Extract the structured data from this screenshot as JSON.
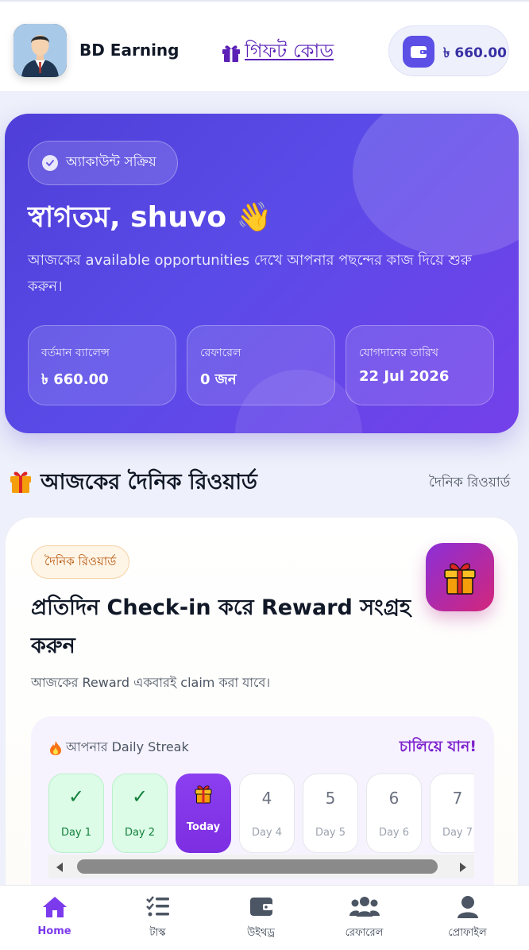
{
  "header": {
    "app_name": "BD Earning",
    "gift_code_label": "গিফট কোড",
    "wallet_amount": "৳ 660.00"
  },
  "hero": {
    "status_chip": "অ্যাকাউন্ট সক্রিয়",
    "welcome": "স্বাগতম, shuvo 👋",
    "description": "আজকের available opportunities দেখে আপনার পছন্দের কাজ দিয়ে শুরু করুন।",
    "stats": [
      {
        "label": "বর্তমান ব্যালেন্স",
        "value": "৳ 660.00"
      },
      {
        "label": "রেফারেল",
        "value": "0 জন"
      },
      {
        "label": "যোগদানের তারিখ",
        "value": "22 Jul 2026"
      }
    ]
  },
  "section": {
    "title": "আজকের দৈনিক রিওয়ার্ড",
    "link": "দৈনিক রিওয়ার্ড"
  },
  "reward": {
    "chip": "দৈনিক রিওয়ার্ড",
    "title": "প্রতিদিন Check-in করে Reward সংগ্রহ করুন",
    "subtitle": "আজকের Reward একবারই claim করা যাবে।",
    "streak_label": "আপনার Daily Streak",
    "streak_cta": "চালিয়ে যান!",
    "days": [
      {
        "mark": "✓",
        "label": "Day 1",
        "state": "done"
      },
      {
        "mark": "✓",
        "label": "Day 2",
        "state": "done"
      },
      {
        "mark": "gift-icon",
        "label": "Today",
        "state": "today"
      },
      {
        "mark": "4",
        "label": "Day 4",
        "state": "upcoming"
      },
      {
        "mark": "5",
        "label": "Day 5",
        "state": "upcoming"
      },
      {
        "mark": "6",
        "label": "Day 6",
        "state": "upcoming"
      },
      {
        "mark": "7",
        "label": "Day 7",
        "state": "upcoming"
      }
    ]
  },
  "nav": {
    "items": [
      {
        "label": "Home",
        "icon": "home-icon",
        "active": true
      },
      {
        "label": "টাস্ক",
        "icon": "tasks-icon",
        "active": false
      },
      {
        "label": "উইথড্র",
        "icon": "wallet-icon",
        "active": false
      },
      {
        "label": "রেফারেল",
        "icon": "users-icon",
        "active": false
      },
      {
        "label": "প্রোফাইল",
        "icon": "user-icon",
        "active": false
      }
    ]
  },
  "colors": {
    "primary": "#5b4fe6",
    "accent_purple": "#7c3aed",
    "success": "#15803d",
    "warning": "#b45309"
  }
}
